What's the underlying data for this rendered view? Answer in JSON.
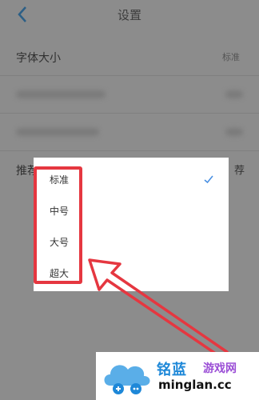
{
  "header": {
    "title": "设置"
  },
  "settings": {
    "font_size": {
      "label": "字体大小",
      "value": "标准"
    },
    "recommend": {
      "label_visible": "推荐",
      "value_visible": "荐"
    }
  },
  "dialog": {
    "options": [
      {
        "label": "标准",
        "selected": true
      },
      {
        "label": "中号",
        "selected": false
      },
      {
        "label": "大号",
        "selected": false
      },
      {
        "label": "超大",
        "selected": false
      }
    ]
  },
  "watermark": {
    "brand_cn": "铭蓝",
    "brand_cn2": "游戏网",
    "domain": "minglan.cc"
  },
  "colors": {
    "accent": "#4a90e2",
    "annotation": "#e53740",
    "overlay": "#8c8c8c"
  },
  "icons": {
    "back": "chevron-left-icon",
    "check": "checkmark-icon",
    "logo": "cloud-gamepad-icon"
  }
}
